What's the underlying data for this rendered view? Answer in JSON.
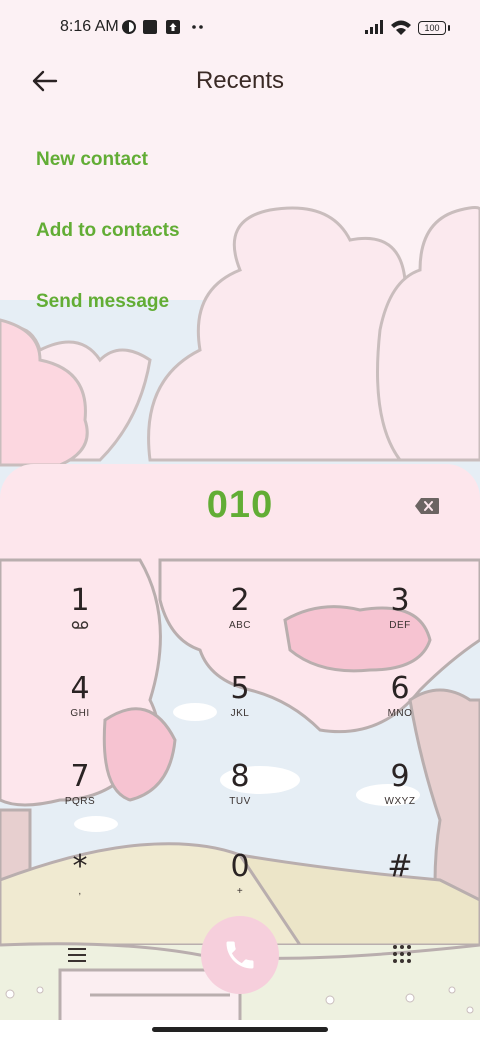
{
  "status_bar": {
    "time": "8:16 AM",
    "battery": "100",
    "icons": [
      "vpn-icon",
      "square-app-icon",
      "upload-icon",
      "more-dots-icon",
      "signal-icon",
      "wifi-icon",
      "battery-icon"
    ]
  },
  "header": {
    "title": "Recents",
    "back_icon": "back-arrow-icon"
  },
  "actions": [
    {
      "label": "New contact"
    },
    {
      "label": "Add to contacts"
    },
    {
      "label": "Send message"
    }
  ],
  "dialer": {
    "number": "010",
    "keys": [
      {
        "digit": "1",
        "letters": ""
      },
      {
        "digit": "2",
        "letters": "ABC"
      },
      {
        "digit": "3",
        "letters": "DEF"
      },
      {
        "digit": "4",
        "letters": "GHI"
      },
      {
        "digit": "5",
        "letters": "JKL"
      },
      {
        "digit": "6",
        "letters": "MNO"
      },
      {
        "digit": "7",
        "letters": "PQRS"
      },
      {
        "digit": "8",
        "letters": "TUV"
      },
      {
        "digit": "9",
        "letters": "WXYZ"
      },
      {
        "digit": "*",
        "letters": ","
      },
      {
        "digit": "0",
        "letters": "+"
      },
      {
        "digit": "#",
        "letters": ""
      }
    ],
    "bottom_bar": {
      "left_icon": "menu-icon",
      "center_icon": "phone-icon",
      "right_icon": "dialpad-grid-icon"
    }
  },
  "colors": {
    "accent_green": "#62ad35",
    "call_button": "#f6cfdc",
    "background": "#fcf1f4",
    "text_dark": "#2a2323"
  }
}
